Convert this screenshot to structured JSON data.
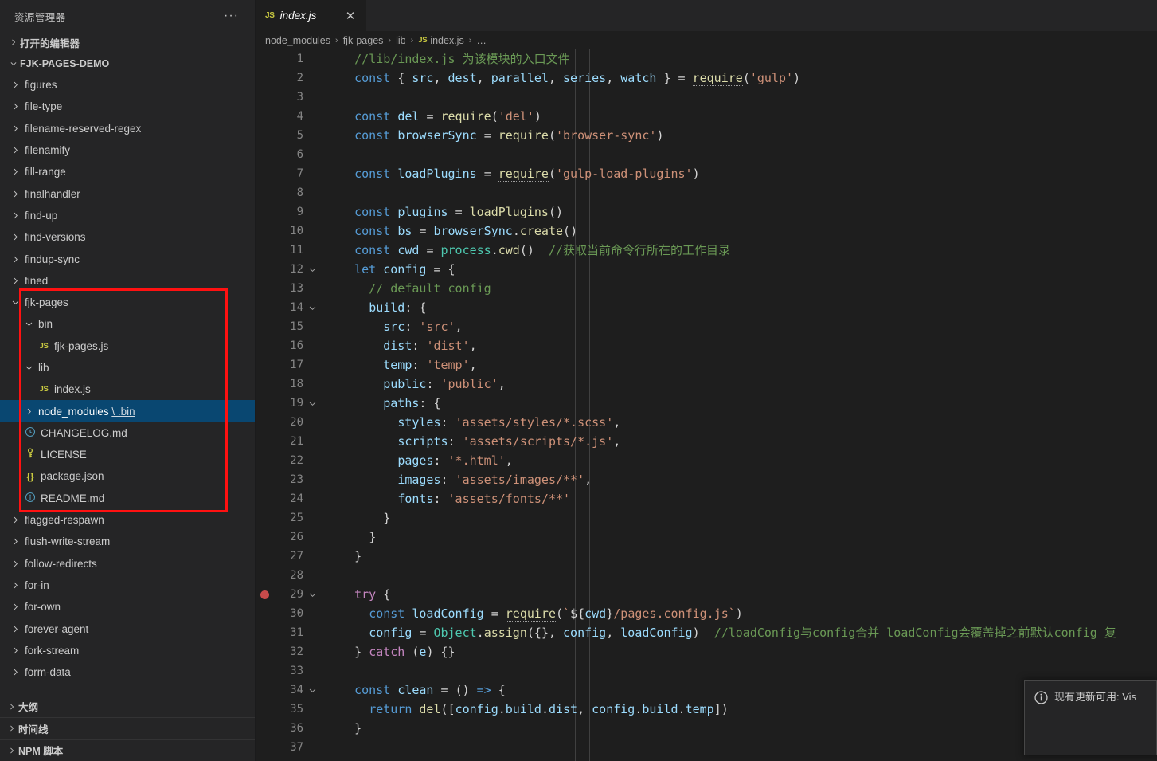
{
  "sidebar": {
    "title": "资源管理器",
    "more_actions": "···",
    "sections": [
      {
        "label": "打开的编辑器",
        "expanded": false
      },
      {
        "label": "FJK-PAGES-DEMO",
        "expanded": true
      }
    ],
    "tree": [
      {
        "label": "figures",
        "type": "folder",
        "depth": 1,
        "expanded": false
      },
      {
        "label": "file-type",
        "type": "folder",
        "depth": 1,
        "expanded": false
      },
      {
        "label": "filename-reserved-regex",
        "type": "folder",
        "depth": 1,
        "expanded": false
      },
      {
        "label": "filenamify",
        "type": "folder",
        "depth": 1,
        "expanded": false
      },
      {
        "label": "fill-range",
        "type": "folder",
        "depth": 1,
        "expanded": false
      },
      {
        "label": "finalhandler",
        "type": "folder",
        "depth": 1,
        "expanded": false
      },
      {
        "label": "find-up",
        "type": "folder",
        "depth": 1,
        "expanded": false
      },
      {
        "label": "find-versions",
        "type": "folder",
        "depth": 1,
        "expanded": false
      },
      {
        "label": "findup-sync",
        "type": "folder",
        "depth": 1,
        "expanded": false
      },
      {
        "label": "fined",
        "type": "folder",
        "depth": 1,
        "expanded": false
      },
      {
        "label": "fjk-pages",
        "type": "folder",
        "depth": 1,
        "expanded": true
      },
      {
        "label": "bin",
        "type": "folder",
        "depth": 2,
        "expanded": true
      },
      {
        "label": "fjk-pages.js",
        "type": "js",
        "depth": 3
      },
      {
        "label": "lib",
        "type": "folder",
        "depth": 2,
        "expanded": true
      },
      {
        "label": "index.js",
        "type": "js",
        "depth": 3
      },
      {
        "label": "node_modules",
        "suffix": "\\ .bin",
        "type": "folder",
        "depth": 2,
        "expanded": false,
        "selected": true
      },
      {
        "label": "CHANGELOG.md",
        "type": "changelog",
        "depth": 2
      },
      {
        "label": "LICENSE",
        "type": "license",
        "depth": 2
      },
      {
        "label": "package.json",
        "type": "json",
        "depth": 2
      },
      {
        "label": "README.md",
        "type": "readme",
        "depth": 2
      },
      {
        "label": "flagged-respawn",
        "type": "folder",
        "depth": 1,
        "expanded": false
      },
      {
        "label": "flush-write-stream",
        "type": "folder",
        "depth": 1,
        "expanded": false
      },
      {
        "label": "follow-redirects",
        "type": "folder",
        "depth": 1,
        "expanded": false
      },
      {
        "label": "for-in",
        "type": "folder",
        "depth": 1,
        "expanded": false
      },
      {
        "label": "for-own",
        "type": "folder",
        "depth": 1,
        "expanded": false
      },
      {
        "label": "forever-agent",
        "type": "folder",
        "depth": 1,
        "expanded": false
      },
      {
        "label": "fork-stream",
        "type": "folder",
        "depth": 1,
        "expanded": false
      },
      {
        "label": "form-data",
        "type": "folder",
        "depth": 1,
        "expanded": false
      }
    ],
    "bottom_panels": [
      {
        "label": "大纲"
      },
      {
        "label": "时间线"
      },
      {
        "label": "NPM 脚本"
      }
    ],
    "annotation_box_color": "#ff1111"
  },
  "editor": {
    "tab": {
      "icon": "JS",
      "name": "index.js",
      "close": "✕"
    },
    "breadcrumb": [
      "node_modules",
      "fjk-pages",
      "lib",
      "index.js",
      "…"
    ],
    "breadcrumb_separator": "›",
    "breadcrumb_file_icon": "JS",
    "breakpoint_line": 29,
    "lines": [
      {
        "n": 1,
        "fold": "",
        "text": "    //lib/index.js 为该模块的入口文件"
      },
      {
        "n": 2,
        "fold": "",
        "text": "    const { src, dest, parallel, series, watch } = require('gulp')"
      },
      {
        "n": 3,
        "fold": "",
        "text": ""
      },
      {
        "n": 4,
        "fold": "",
        "text": "    const del = require('del')"
      },
      {
        "n": 5,
        "fold": "",
        "text": "    const browserSync = require('browser-sync')"
      },
      {
        "n": 6,
        "fold": "",
        "text": ""
      },
      {
        "n": 7,
        "fold": "",
        "text": "    const loadPlugins = require('gulp-load-plugins')"
      },
      {
        "n": 8,
        "fold": "",
        "text": ""
      },
      {
        "n": 9,
        "fold": "",
        "text": "    const plugins = loadPlugins()"
      },
      {
        "n": 10,
        "fold": "",
        "text": "    const bs = browserSync.create()"
      },
      {
        "n": 11,
        "fold": "",
        "text": "    const cwd = process.cwd()  //获取当前命令行所在的工作目录"
      },
      {
        "n": 12,
        "fold": "v",
        "text": "    let config = {"
      },
      {
        "n": 13,
        "fold": "",
        "text": "      // default config"
      },
      {
        "n": 14,
        "fold": "v",
        "text": "      build: {"
      },
      {
        "n": 15,
        "fold": "",
        "text": "        src: 'src',"
      },
      {
        "n": 16,
        "fold": "",
        "text": "        dist: 'dist',"
      },
      {
        "n": 17,
        "fold": "",
        "text": "        temp: 'temp',"
      },
      {
        "n": 18,
        "fold": "",
        "text": "        public: 'public',"
      },
      {
        "n": 19,
        "fold": "v",
        "text": "        paths: {"
      },
      {
        "n": 20,
        "fold": "",
        "text": "          styles: 'assets/styles/*.scss',"
      },
      {
        "n": 21,
        "fold": "",
        "text": "          scripts: 'assets/scripts/*.js',"
      },
      {
        "n": 22,
        "fold": "",
        "text": "          pages: '*.html',"
      },
      {
        "n": 23,
        "fold": "",
        "text": "          images: 'assets/images/**',"
      },
      {
        "n": 24,
        "fold": "",
        "text": "          fonts: 'assets/fonts/**'"
      },
      {
        "n": 25,
        "fold": "",
        "text": "        }"
      },
      {
        "n": 26,
        "fold": "",
        "text": "      }"
      },
      {
        "n": 27,
        "fold": "",
        "text": "    }"
      },
      {
        "n": 28,
        "fold": "",
        "text": ""
      },
      {
        "n": 29,
        "fold": "v",
        "text": "    try {"
      },
      {
        "n": 30,
        "fold": "",
        "text": "      const loadConfig = require(`${cwd}/pages.config.js`)"
      },
      {
        "n": 31,
        "fold": "",
        "text": "      config = Object.assign({}, config, loadConfig)  //loadConfig与config合并 loadConfig会覆盖掉之前默认config 复"
      },
      {
        "n": 32,
        "fold": "",
        "text": "    } catch (e) {}"
      },
      {
        "n": 33,
        "fold": "",
        "text": ""
      },
      {
        "n": 34,
        "fold": "v",
        "text": "    const clean = () => {"
      },
      {
        "n": 35,
        "fold": "",
        "text": "      return del([config.build.dist, config.build.temp])"
      },
      {
        "n": 36,
        "fold": "",
        "text": "    }"
      },
      {
        "n": 37,
        "fold": "",
        "text": ""
      }
    ]
  },
  "notification": {
    "icon": "info-icon",
    "message": "现有更新可用: Vis"
  },
  "colors": {
    "sidebar_bg": "#252526",
    "editor_bg": "#1e1e1e",
    "selection_blue": "#094771",
    "keyword": "#569cd6",
    "control_keyword": "#c586c0",
    "string": "#ce9178",
    "comment": "#6a9955",
    "variable": "#9cdcfe",
    "function": "#dcdcaa",
    "type": "#4ec9b0",
    "breakpoint": "#c84b4b",
    "js_icon": "#cbcb41"
  }
}
